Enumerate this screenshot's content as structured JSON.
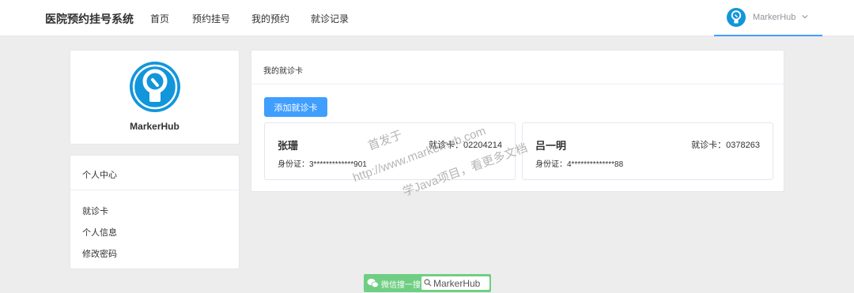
{
  "header": {
    "app_title": "医院预约挂号系统",
    "nav": [
      "首页",
      "预约挂号",
      "我的预约",
      "就诊记录"
    ],
    "user_name": "MarkerHub"
  },
  "profile": {
    "name": "MarkerHub"
  },
  "menu": {
    "title": "个人中心",
    "items": [
      "就诊卡",
      "个人信息",
      "修改密码"
    ]
  },
  "main": {
    "title": "我的就诊卡",
    "add_button": "添加就诊卡",
    "cards": [
      {
        "name": "张珊",
        "card_no": "就诊卡：02204214",
        "id": "身份证：3*************901"
      },
      {
        "name": "吕一明",
        "card_no": "就诊卡：0378263",
        "id": "身份证：4**************88"
      }
    ]
  },
  "watermark": [
    "首发于",
    "http://www.markerhub.com",
    "学Java项目，看更多文档"
  ],
  "badge": {
    "text": "微信搜一搜",
    "search": "MarkerHub"
  },
  "colors": {
    "primary": "#409eff",
    "logo_blue": "#1296db",
    "badge_green": "#6fce83"
  }
}
